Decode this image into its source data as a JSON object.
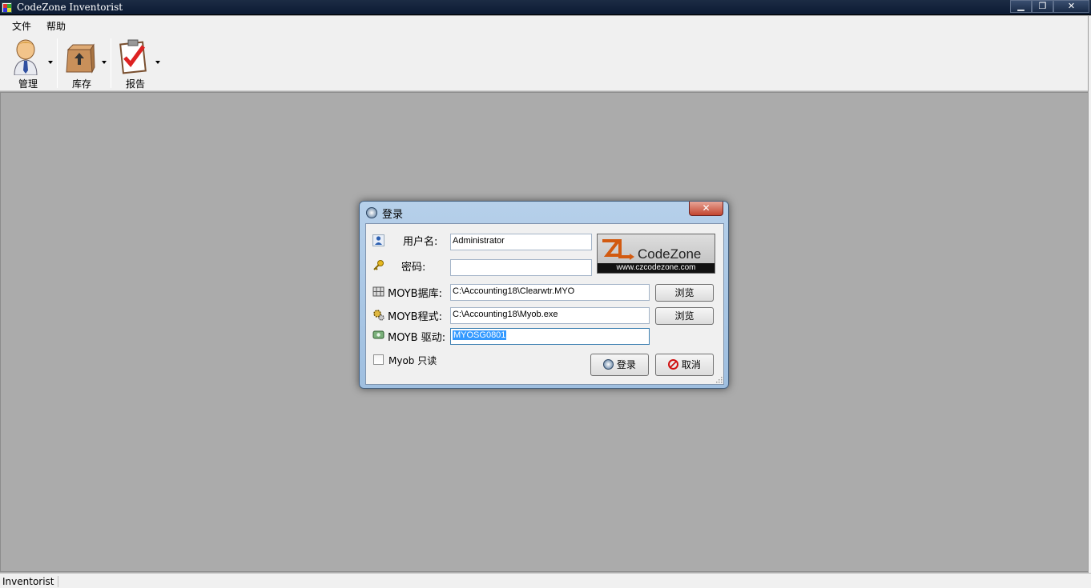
{
  "window": {
    "title": "CodeZone Inventorist",
    "buttons": {
      "minimize": "▁",
      "restore": "❐",
      "close": "✕"
    }
  },
  "menu": [
    {
      "label": "文件"
    },
    {
      "label": "帮助"
    }
  ],
  "toolbar": [
    {
      "label": "管理",
      "icon": "user-icon"
    },
    {
      "label": "库存",
      "icon": "box-icon"
    },
    {
      "label": "报告",
      "icon": "clipboard-check-icon"
    }
  ],
  "status": {
    "text": "Inventorist"
  },
  "dialog": {
    "title": "登录",
    "close": "✕",
    "username": {
      "label": "用户名:",
      "value": "Administrator"
    },
    "password": {
      "label": "密码:",
      "value": ""
    },
    "moyb_db": {
      "label": "MOYB据库:",
      "value": "C:\\Accounting18\\Clearwtr.MYO",
      "browse": "浏览"
    },
    "moyb_exe": {
      "label": "MOYB程式:",
      "value": "C:\\Accounting18\\Myob.exe",
      "browse": "浏览"
    },
    "moyb_driver": {
      "label": "MOYB 驱动:",
      "value": "MYOSG0801"
    },
    "readonly": {
      "label": "Myob 只读",
      "checked": false
    },
    "login_button": "登录",
    "cancel_button": "取消",
    "logo": {
      "text": "CodeZone",
      "url": "www.czcodezone.com"
    }
  },
  "colors": {
    "titlebar": "#0b1a33",
    "workspace": "#ababab",
    "dialog_frame": "#b6d0ea",
    "selection": "#3399ff"
  }
}
